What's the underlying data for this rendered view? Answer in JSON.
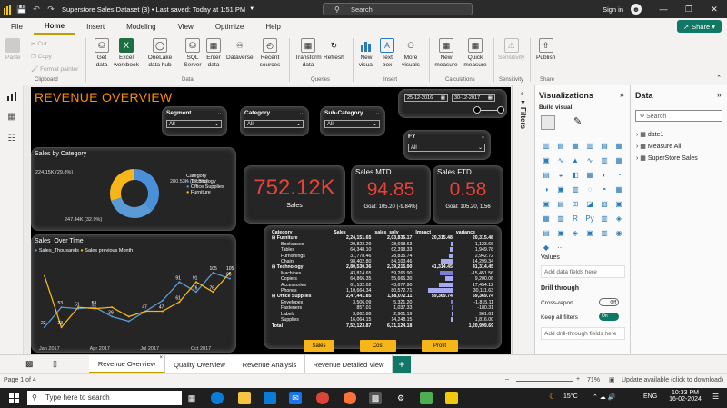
{
  "titlebar": {
    "title": "Superstore Sales Dataset (3) • Last saved: Today at 1:51 PM",
    "search": "Search",
    "signin": "Sign in"
  },
  "menu": [
    "File",
    "Home",
    "Insert",
    "Modeling",
    "View",
    "Optimize",
    "Help"
  ],
  "menu_active": "Home",
  "share_label": "Share",
  "ribbon": {
    "paste": "Paste",
    "cut": "Cut",
    "copy": "Copy",
    "format_painter": "Format painter",
    "get_data": "Get data",
    "excel": "Excel workbook",
    "onelake": "OneLake data hub",
    "sql": "SQL Server",
    "enter_data": "Enter data",
    "dataverse": "Dataverse",
    "recent": "Recent sources",
    "transform": "Transform data",
    "refresh": "Refresh",
    "new_visual": "New visual",
    "text_box": "Text box",
    "more_visuals": "More visuals",
    "new_measure": "New measure",
    "quick_measure": "Quick measure",
    "sensitivity": "Sensitivity",
    "publish": "Publish",
    "groups": {
      "clipboard": "Clipboard",
      "data": "Data",
      "queries": "Queries",
      "insert": "Insert",
      "calculations": "Calculations",
      "sensitivity": "Sensitivity",
      "share": "Share"
    }
  },
  "report": {
    "title": "REVENUE OVERVIEW",
    "date_from": "25-12-2016",
    "date_to": "30-12-2017",
    "slicers": [
      {
        "label": "Segment",
        "value": "All"
      },
      {
        "label": "Category",
        "value": "All"
      },
      {
        "label": "Sub-Category",
        "value": "All"
      },
      {
        "label": "FY",
        "value": "All"
      }
    ],
    "kpi_sales": {
      "value": "752.12K",
      "label": "Sales"
    },
    "kpi_mtd": {
      "label": "Sales MTD",
      "value": "94.85",
      "goal": "Goal: 105.20 (-9.84%)"
    },
    "kpi_ftd": {
      "label": "Sales FTD",
      "value": "0.58",
      "goal": "Goal: 105.20, 1.56"
    },
    "donut": {
      "title": "Sales by Category",
      "legend_title": "Category",
      "slices": [
        {
          "name": "Technology",
          "value": 280.53,
          "label": "280.53K (37.3%)",
          "color": "#4a90d9"
        },
        {
          "name": "Office Supplies",
          "value": 247.44,
          "label": "247.44K (32.9%)",
          "color": "#5b9bd5"
        },
        {
          "name": "Furniture",
          "value": 224.15,
          "label": "224.15K (29.8%)",
          "color": "#f6b61a"
        }
      ]
    },
    "line": {
      "title": "Sales_Over Time",
      "legend": [
        {
          "name": "Sales_Thousands",
          "color": "#5b9bd5"
        },
        {
          "name": "Sales previous Month",
          "color": "#f6b61a"
        }
      ],
      "x_labels": [
        "Jan 2017",
        "Apr 2017",
        "Jul 2017",
        "Oct 2017"
      ]
    },
    "matrix": {
      "headers": [
        "Category",
        "Sales",
        "sales_sply",
        "Impact",
        "variance"
      ],
      "rows": [
        {
          "name": "⊟ Furniture",
          "level": 0,
          "sales": "2,24,151.65",
          "sply": "2,03,836.17",
          "impact": "20,315.48",
          "variance": "20,315.48",
          "bar": 0
        },
        {
          "name": "Bookcases",
          "level": 1,
          "sales": "29,822.29",
          "sply": "28,698.63",
          "impact": "",
          "variance": "1,123.66",
          "bar": 2
        },
        {
          "name": "Tables",
          "level": 1,
          "sales": "64,348.10",
          "sply": "62,398.33",
          "impact": "",
          "variance": "1,949.78",
          "bar": 3
        },
        {
          "name": "Furnishings",
          "level": 1,
          "sales": "31,778.46",
          "sply": "28,835.74",
          "impact": "",
          "variance": "2,942.72",
          "bar": 4
        },
        {
          "name": "Chairs",
          "level": 1,
          "sales": "98,402.80",
          "sply": "84,103.46",
          "impact": "",
          "variance": "14,299.34",
          "bar": 14
        },
        {
          "name": "⊟ Technology",
          "level": 0,
          "sales": "2,80,530.36",
          "sply": "2,39,215.90",
          "impact": "41,314.45",
          "variance": "41,314.45",
          "bar": 0
        },
        {
          "name": "Machines",
          "level": 1,
          "sales": "43,814.65",
          "sply": "59,265.90",
          "impact": "",
          "variance": "-15,451.56",
          "bar": -15
        },
        {
          "name": "Copiers",
          "level": 1,
          "sales": "64,866.35",
          "sply": "55,666.30",
          "impact": "",
          "variance": "9,200.06",
          "bar": 9
        },
        {
          "name": "Accessories",
          "level": 1,
          "sales": "61,132.02",
          "sply": "43,677.90",
          "impact": "",
          "variance": "17,454.12",
          "bar": 17
        },
        {
          "name": "Phones",
          "level": 1,
          "sales": "1,10,664.34",
          "sply": "80,572.71",
          "impact": "",
          "variance": "30,111.63",
          "bar": 30
        },
        {
          "name": "⊟ Office Supplies",
          "level": 0,
          "sales": "2,47,441.85",
          "sply": "1,88,072.11",
          "impact": "59,369.74",
          "variance": "59,369.74",
          "bar": 0
        },
        {
          "name": "Envelopes",
          "level": 1,
          "sales": "3,506.09",
          "sply": "5,321.20",
          "impact": "",
          "variance": "-1,815.11",
          "bar": -2
        },
        {
          "name": "Fasteners",
          "level": 1,
          "sales": "857.01",
          "sply": "1,037.33",
          "impact": "",
          "variance": "-180.31",
          "bar": -1
        },
        {
          "name": "Labels",
          "level": 1,
          "sales": "3,862.88",
          "sply": "2,901.19",
          "impact": "",
          "variance": "961.61",
          "bar": 1
        },
        {
          "name": "Supplies",
          "level": 1,
          "sales": "16,064.15",
          "sply": "14,248.15",
          "impact": "",
          "variance": "1,816.00",
          "bar": 2
        }
      ],
      "total": {
        "name": "Total",
        "sales": "7,52,123.87",
        "sply": "6,31,124.18",
        "impact": "",
        "variance": "1,20,999.69"
      },
      "buttons": [
        "Sales",
        "Cost",
        "Profit"
      ]
    }
  },
  "chart_data": {
    "type": "line",
    "title": "Sales_Over Time",
    "x": [
      "Jan 2017",
      "Feb 2017",
      "Mar 2017",
      "Apr 2017",
      "May 2017",
      "Jun 2017",
      "Jul 2017",
      "Aug 2017",
      "Sep 2017",
      "Oct 2017",
      "Nov 2017",
      "Dec 2017"
    ],
    "series": [
      {
        "name": "Sales_Thousands",
        "values": [
          23,
          53,
          51,
          53,
          39,
          32,
          47,
          63,
          91,
          76,
          105,
          96
        ]
      },
      {
        "name": "Sales previous Month",
        "values": [
          100,
          23,
          53,
          51,
          53,
          39,
          47,
          47,
          61,
          91,
          76,
          105
        ]
      }
    ],
    "data_labels": [
      "100",
      "105",
      "23",
      "53",
      "51",
      "53",
      "39",
      "47",
      "47",
      "91",
      "61",
      "76",
      "91",
      "76",
      "105",
      "105",
      "96"
    ],
    "ylim": [
      0,
      120
    ],
    "legend": "top"
  },
  "visualizations": {
    "title": "Visualizations",
    "build": "Build visual",
    "values": "Values",
    "add_data": "Add data fields here",
    "drill": "Drill through",
    "cross": "Cross-report",
    "cross_state": "Off",
    "keep": "Keep all filters",
    "keep_state": "On",
    "add_drill": "Add drill-through fields here"
  },
  "data_pane": {
    "title": "Data",
    "search": "Search",
    "tables": [
      "date1",
      "Measure All",
      "SuperStore Sales"
    ]
  },
  "filters_label": "Filters",
  "page_tabs": [
    "Revenue Overview",
    "Quality Overview",
    "Revenue Analysis",
    "Revenue Detailed View"
  ],
  "status": {
    "page": "Page 1 of 4",
    "zoom": "71%",
    "update": "Update available (click to download)"
  },
  "taskbar": {
    "search": "Type here to search",
    "temp": "15°C",
    "lang": "ENG",
    "time": "10:33 PM",
    "date": "16-02-2024"
  }
}
